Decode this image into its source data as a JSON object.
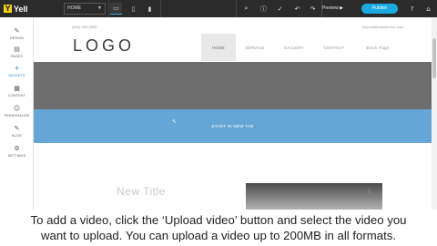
{
  "app": {
    "brand_mark": "Y",
    "brand_name": "Yell"
  },
  "toolbar": {
    "page_select_value": "HOME",
    "device_icons": [
      "desktop-icon",
      "tablet-icon",
      "mobile-icon"
    ],
    "tool_icons": [
      "search-icon",
      "info-icon",
      "check-icon",
      "undo-icon",
      "redo-icon",
      "settings-icon"
    ],
    "preview_label": "Preview ▶",
    "publish_label": "Publish",
    "help_icon": "?",
    "home_icon": "⌂"
  },
  "sidebar": {
    "items": [
      {
        "icon": "design-icon",
        "glyph": "✎",
        "label": "DESIGN"
      },
      {
        "icon": "pages-icon",
        "glyph": "▤",
        "label": "PAGES"
      },
      {
        "icon": "plus-icon",
        "glyph": "+",
        "label": "WIDGETS"
      },
      {
        "icon": "content-icon",
        "glyph": "▦",
        "label": "CONTENT"
      },
      {
        "icon": "personalize-icon",
        "glyph": "☺",
        "label": "PERSONALIZE"
      },
      {
        "icon": "blog-icon",
        "glyph": "✎",
        "label": "BLOG"
      },
      {
        "icon": "settings-icon",
        "glyph": "⚙",
        "label": "SETTINGS"
      }
    ]
  },
  "site": {
    "phone": "(555) 555-5555",
    "email": "mymail@mailservice.com",
    "logo": "LOGO",
    "nav": [
      "HOME",
      "SERVICE",
      "GALLERY",
      "CONTACT",
      "Block Page"
    ],
    "hero_text": "START IN NEW TAB",
    "new_title": "New Title"
  },
  "caption": {
    "line1": "To add a video, click the ‘Upload video’ button and select the video you",
    "line2": "want to upload. You can upload a video up to 200MB in all formats."
  },
  "colors": {
    "toolbar_bg": "#2b2b2b",
    "accent": "#1ba9e1",
    "hero_grey": "#6e6e6e",
    "hero_blue": "#66a6d6",
    "brand_yellow": "#f5d312"
  }
}
